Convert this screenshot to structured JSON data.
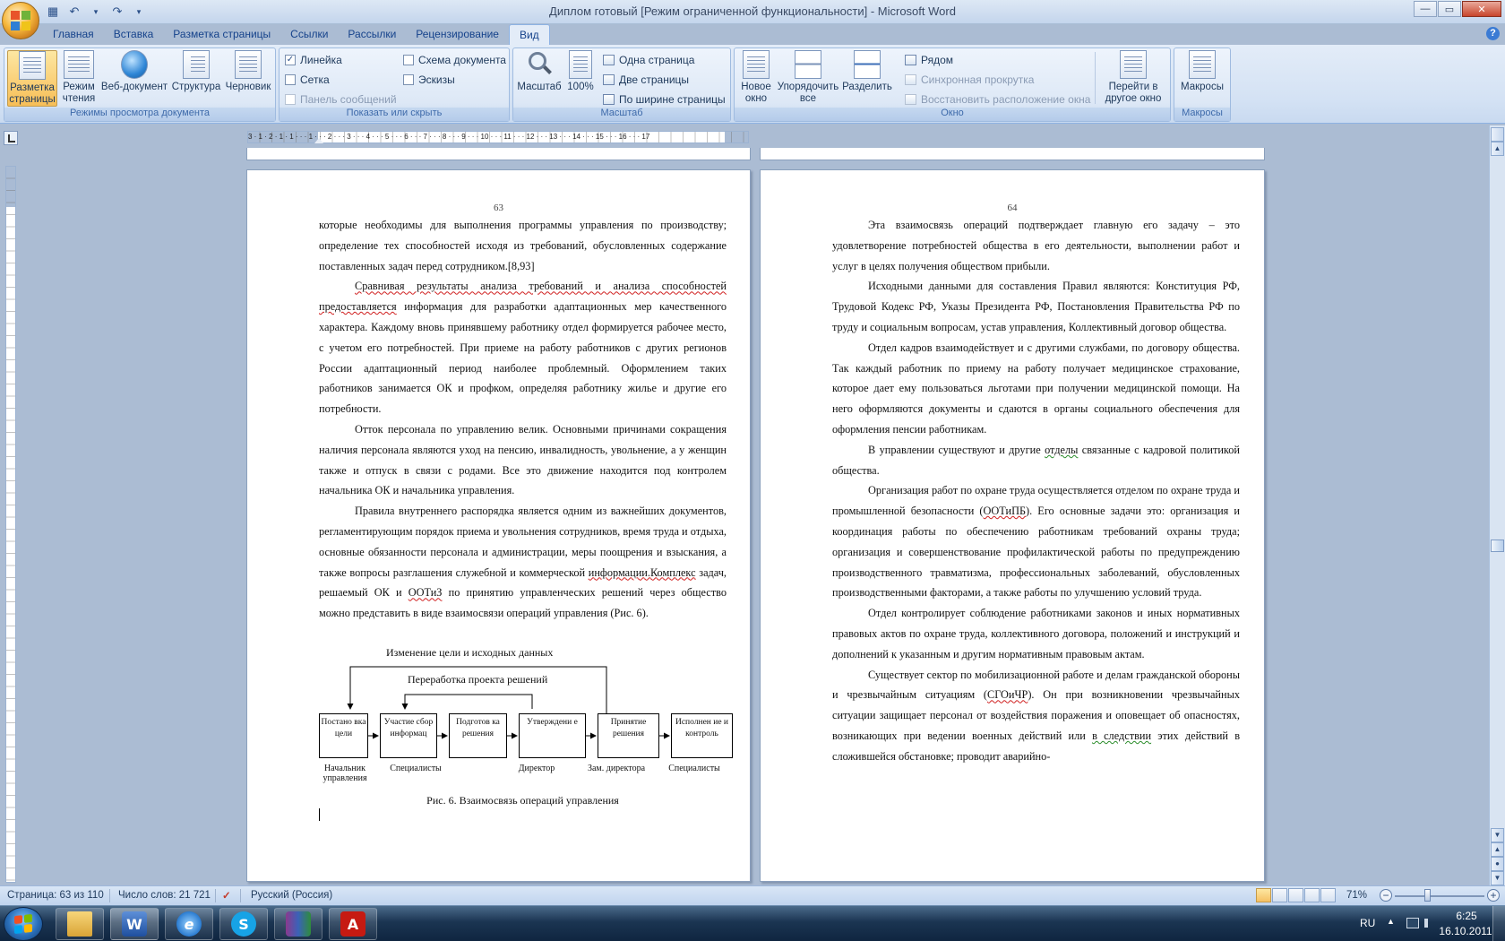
{
  "window": {
    "title": "Диплом готовый [Режим ограниченной функциональности] - Microsoft Word",
    "controls": {
      "minimize": "—",
      "maximize": "▭",
      "close": "✕"
    }
  },
  "qat": {
    "save_icon": "💾",
    "undo_icon": "↶",
    "redo_icon": "↷",
    "more": "▾"
  },
  "tabs": [
    "Главная",
    "Вставка",
    "Разметка страницы",
    "Ссылки",
    "Рассылки",
    "Рецензирование",
    "Вид"
  ],
  "active_tab": "Вид",
  "ribbon": {
    "views_group": {
      "label": "Режимы просмотра документа",
      "buttons": [
        "Разметка страницы",
        "Режим чтения",
        "Веб-документ",
        "Структура",
        "Черновик"
      ]
    },
    "show_group": {
      "label": "Показать или скрыть",
      "ruler": "Линейка",
      "grid": "Сетка",
      "message_bar": "Панель сообщений",
      "doc_map": "Схема документа",
      "thumbs": "Эскизы",
      "ruler_checked": "✓"
    },
    "zoom_group": {
      "label": "Масштаб",
      "zoom": "Масштаб",
      "hundred": "100%",
      "one_page": "Одна страница",
      "two_pages": "Две страницы",
      "page_width": "По ширине страницы"
    },
    "window_group": {
      "label": "Окно",
      "new_window": "Новое окно",
      "arrange_all": "Упорядочить все",
      "split": "Разделить",
      "side_by_side": "Рядом",
      "sync_scroll": "Синхронная прокрутка",
      "reset_pos": "Восстановить расположение окна",
      "switch_windows": "Перейти в другое окно"
    },
    "macros_group": {
      "label": "Макросы",
      "macros": "Макросы"
    }
  },
  "ruler": {
    "labels": "3 · 1 · 2 · 1 · 1 · · · 1 · · · 2 · · · 3 · · · 4 · · · 5 · · · 6 · · · 7 · · · 8 · · · 9 · · · 10 · · · 11 · · · 12 · · · 13 · · · 14 · · · 15 · · · 16 · · · 17"
  },
  "page_left": {
    "number": "63",
    "p1": "которые необходимы для выполнения программы управления по производству; определение тех способностей исходя из требований, обусловленных содержание поставленных задач перед сотрудником.[8,93]",
    "p2a": "Сравнивая результаты анализа требований и анализа способностей предоставляется",
    "p2b": " информация для разработки адаптационных мер качественного характера. Каждому вновь принявшему работнику отдел формируется рабочее место, с учетом его потребностей. При приеме на работу работников с других регионов России адаптационный период  наиболее проблемный. Оформлением таких работников занимается ОК и профком, определяя работнику жилье  и другие его потребности.",
    "p3": "Отток персонала по управлению велик. Основными причинами сокращения наличия персонала являются уход на пенсию, инвалидность, увольнение, а у женщин также и отпуск в связи с родами. Все  это движение находится под контролем начальника ОК и начальника управления.",
    "p4a": "Правила внутреннего распорядка является одним из важнейших документов, регламентирующим порядок приема и увольнения сотрудников, время труда и отдыха, основные обязанности персонала и администрации, меры поощрения и взыскания, а также вопросы разглашения служебной и коммерческой ",
    "p4b": "информации.Комплекс",
    "p4c": " задач, решаемый ОК и ",
    "p4d": "ООТиЗ",
    "p4e": " по принятию управленческих решений через общество можно представить в виде взаимосвязи операций управления (Рис. 6).",
    "caption": "Рис. 6. Взаимосвязь операций управления"
  },
  "diagram": {
    "top_label": "Изменение цели и исходных данных",
    "mid_label": "Переработка проекта решений",
    "boxes": [
      "Постано вка цели",
      "Участие сбор информац",
      "Подготов ка решения",
      "Утверждени е",
      "Принятие решения",
      "Исполнен ие и контроль"
    ],
    "roles": [
      "Начальник управления",
      "Специалисты",
      "Директор",
      "Зам. директора",
      "Специалисты"
    ]
  },
  "page_right": {
    "number": "64",
    "p1": "Эта взаимосвязь операций подтверждает главную его задачу – это удовлетворение потребностей общества в его деятельности, выполнении работ и услуг в целях получения обществом прибыли.",
    "p2": "Исходными данными для составления Правил являются: Конституция РФ, Трудовой Кодекс РФ, Указы Президента РФ, Постановления Правительства РФ по труду и социальным вопросам, устав управления, Коллективный договор общества.",
    "p3": "Отдел кадров взаимодействует и с другими службами, по договору общества. Так каждый работник по приему на работу получает медицинское страхование, которое дает ему пользоваться льготами при получении медицинской помощи. На него  оформляются документы и сдаются в органы социального обеспечения для оформления пенсии работникам.",
    "p4a": "В управлении существуют и другие ",
    "p4b": "отделы",
    "p4c": " связанные с кадровой политикой общества.",
    "p5a": "Организация работ по охране труда осуществляется отделом по охране труда и промышленной безопасности (",
    "p5b": "ООТиПБ",
    "p5c": "). Его основные задачи  это: организация и координация работы по обеспечению работникам требований охраны труда; организация и совершенствование профилактической работы по предупреждению производственного травматизма, профессиональных заболеваний, обусловленных производственными факторами, а также работы по улучшению условий труда.",
    "p6": "Отдел контролирует соблюдение работниками законов и иных нормативных правовых актов по охране труда, коллективного договора, положений и инструкций и дополнений к указанным и другим нормативным правовым актам.",
    "p7a": "Существует сектор по мобилизационной работе и делам гражданской обороны и чрезвычайным ситуациям (",
    "p7b": "СГОиЧР",
    "p7c": "). Он при возникновении чрезвычайных ситуации защищает персонал от воздействия поражения и оповещает об опасностях, возникающих при ведении военных действий или ",
    "p7d": "в следствии",
    "p7e": " этих действий в сложившейся обстановке; проводит аварийно-"
  },
  "status": {
    "page": "Страница: 63 из 110",
    "words": "Число слов: 21 721",
    "language": "Русский (Россия)",
    "zoom": "71%",
    "zoom_minus": "−",
    "zoom_plus": "+"
  },
  "taskbar": {
    "lang": "RU",
    "time": "6:25",
    "date": "16.10.2011",
    "tray_arrow": "▲",
    "apps": [
      "explorer",
      "word",
      "ie",
      "skype",
      "winrar",
      "acrobat"
    ]
  },
  "colors": {
    "ribbon_blue": "#dde8f5",
    "accent_active": "#f7be57",
    "taskbar": "#1b3552"
  }
}
